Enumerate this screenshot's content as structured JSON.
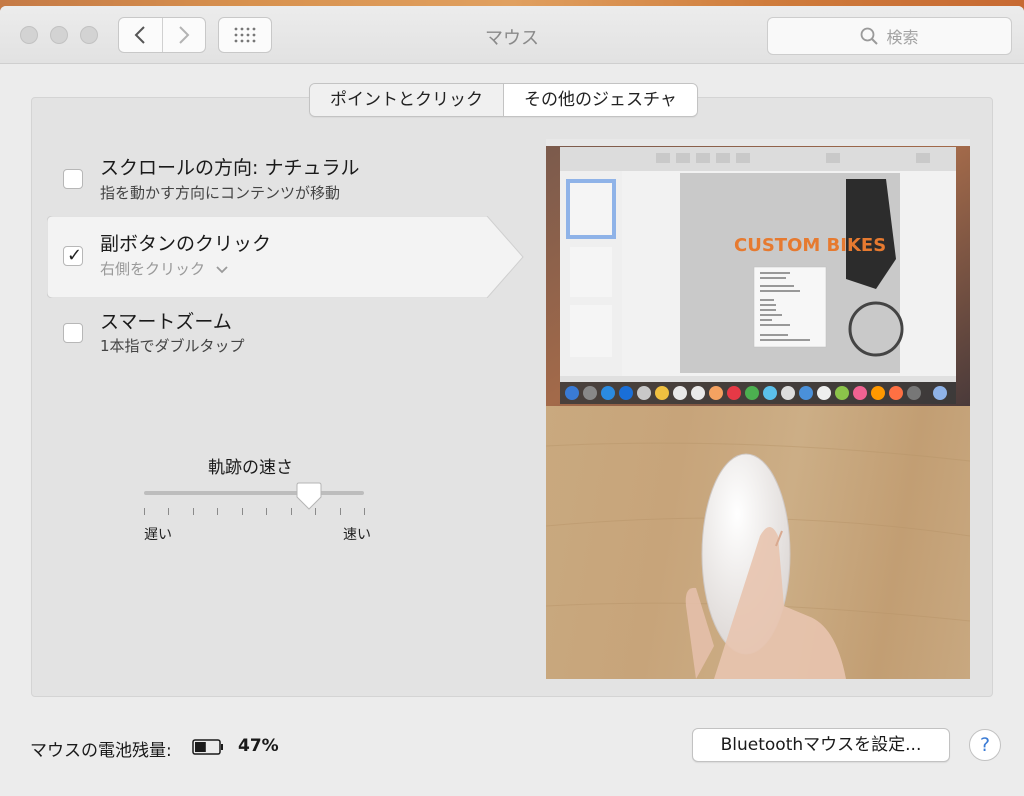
{
  "window": {
    "title": "マウス"
  },
  "search": {
    "placeholder": "検索"
  },
  "tabs": [
    {
      "label": "ポイントとクリック",
      "active": false
    },
    {
      "label": "その他のジェスチャ",
      "active": true
    }
  ],
  "options": [
    {
      "title": "スクロールの方向: ナチュラル",
      "subtitle": "指を動かす方向にコンテンツが移動",
      "checked": false
    },
    {
      "title": "副ボタンのクリック",
      "subtitle": "右側をクリック",
      "checked": true,
      "has_dropdown": true
    },
    {
      "title": "スマートズーム",
      "subtitle": "1本指でダブルタップ",
      "checked": false
    }
  ],
  "tracking_speed": {
    "title": "軌跡の速さ",
    "min_label": "遅い",
    "max_label": "速い",
    "value_fraction": 0.75,
    "tick_count": 10
  },
  "preview": {
    "doc_heading": "CUSTOM BIKES",
    "context_menu": [
      "Bring to Front",
      "Send to Back",
      "Align Objects",
      "Distribute Objects",
      "Cut",
      "Copy",
      "Paste",
      "Duplicate",
      "Lock",
      "Make Editable",
      "Insert Image",
      "Capture Selection from Screen"
    ]
  },
  "footer": {
    "battery_label": "マウスの電池残量:",
    "battery_value": "47%",
    "battery_level": 0.47,
    "bluetooth_button": "Bluetoothマウスを設定...",
    "help_label": "?"
  },
  "colors": {
    "accent": "#3a7bd5",
    "preview_orange": "#e67a30"
  }
}
